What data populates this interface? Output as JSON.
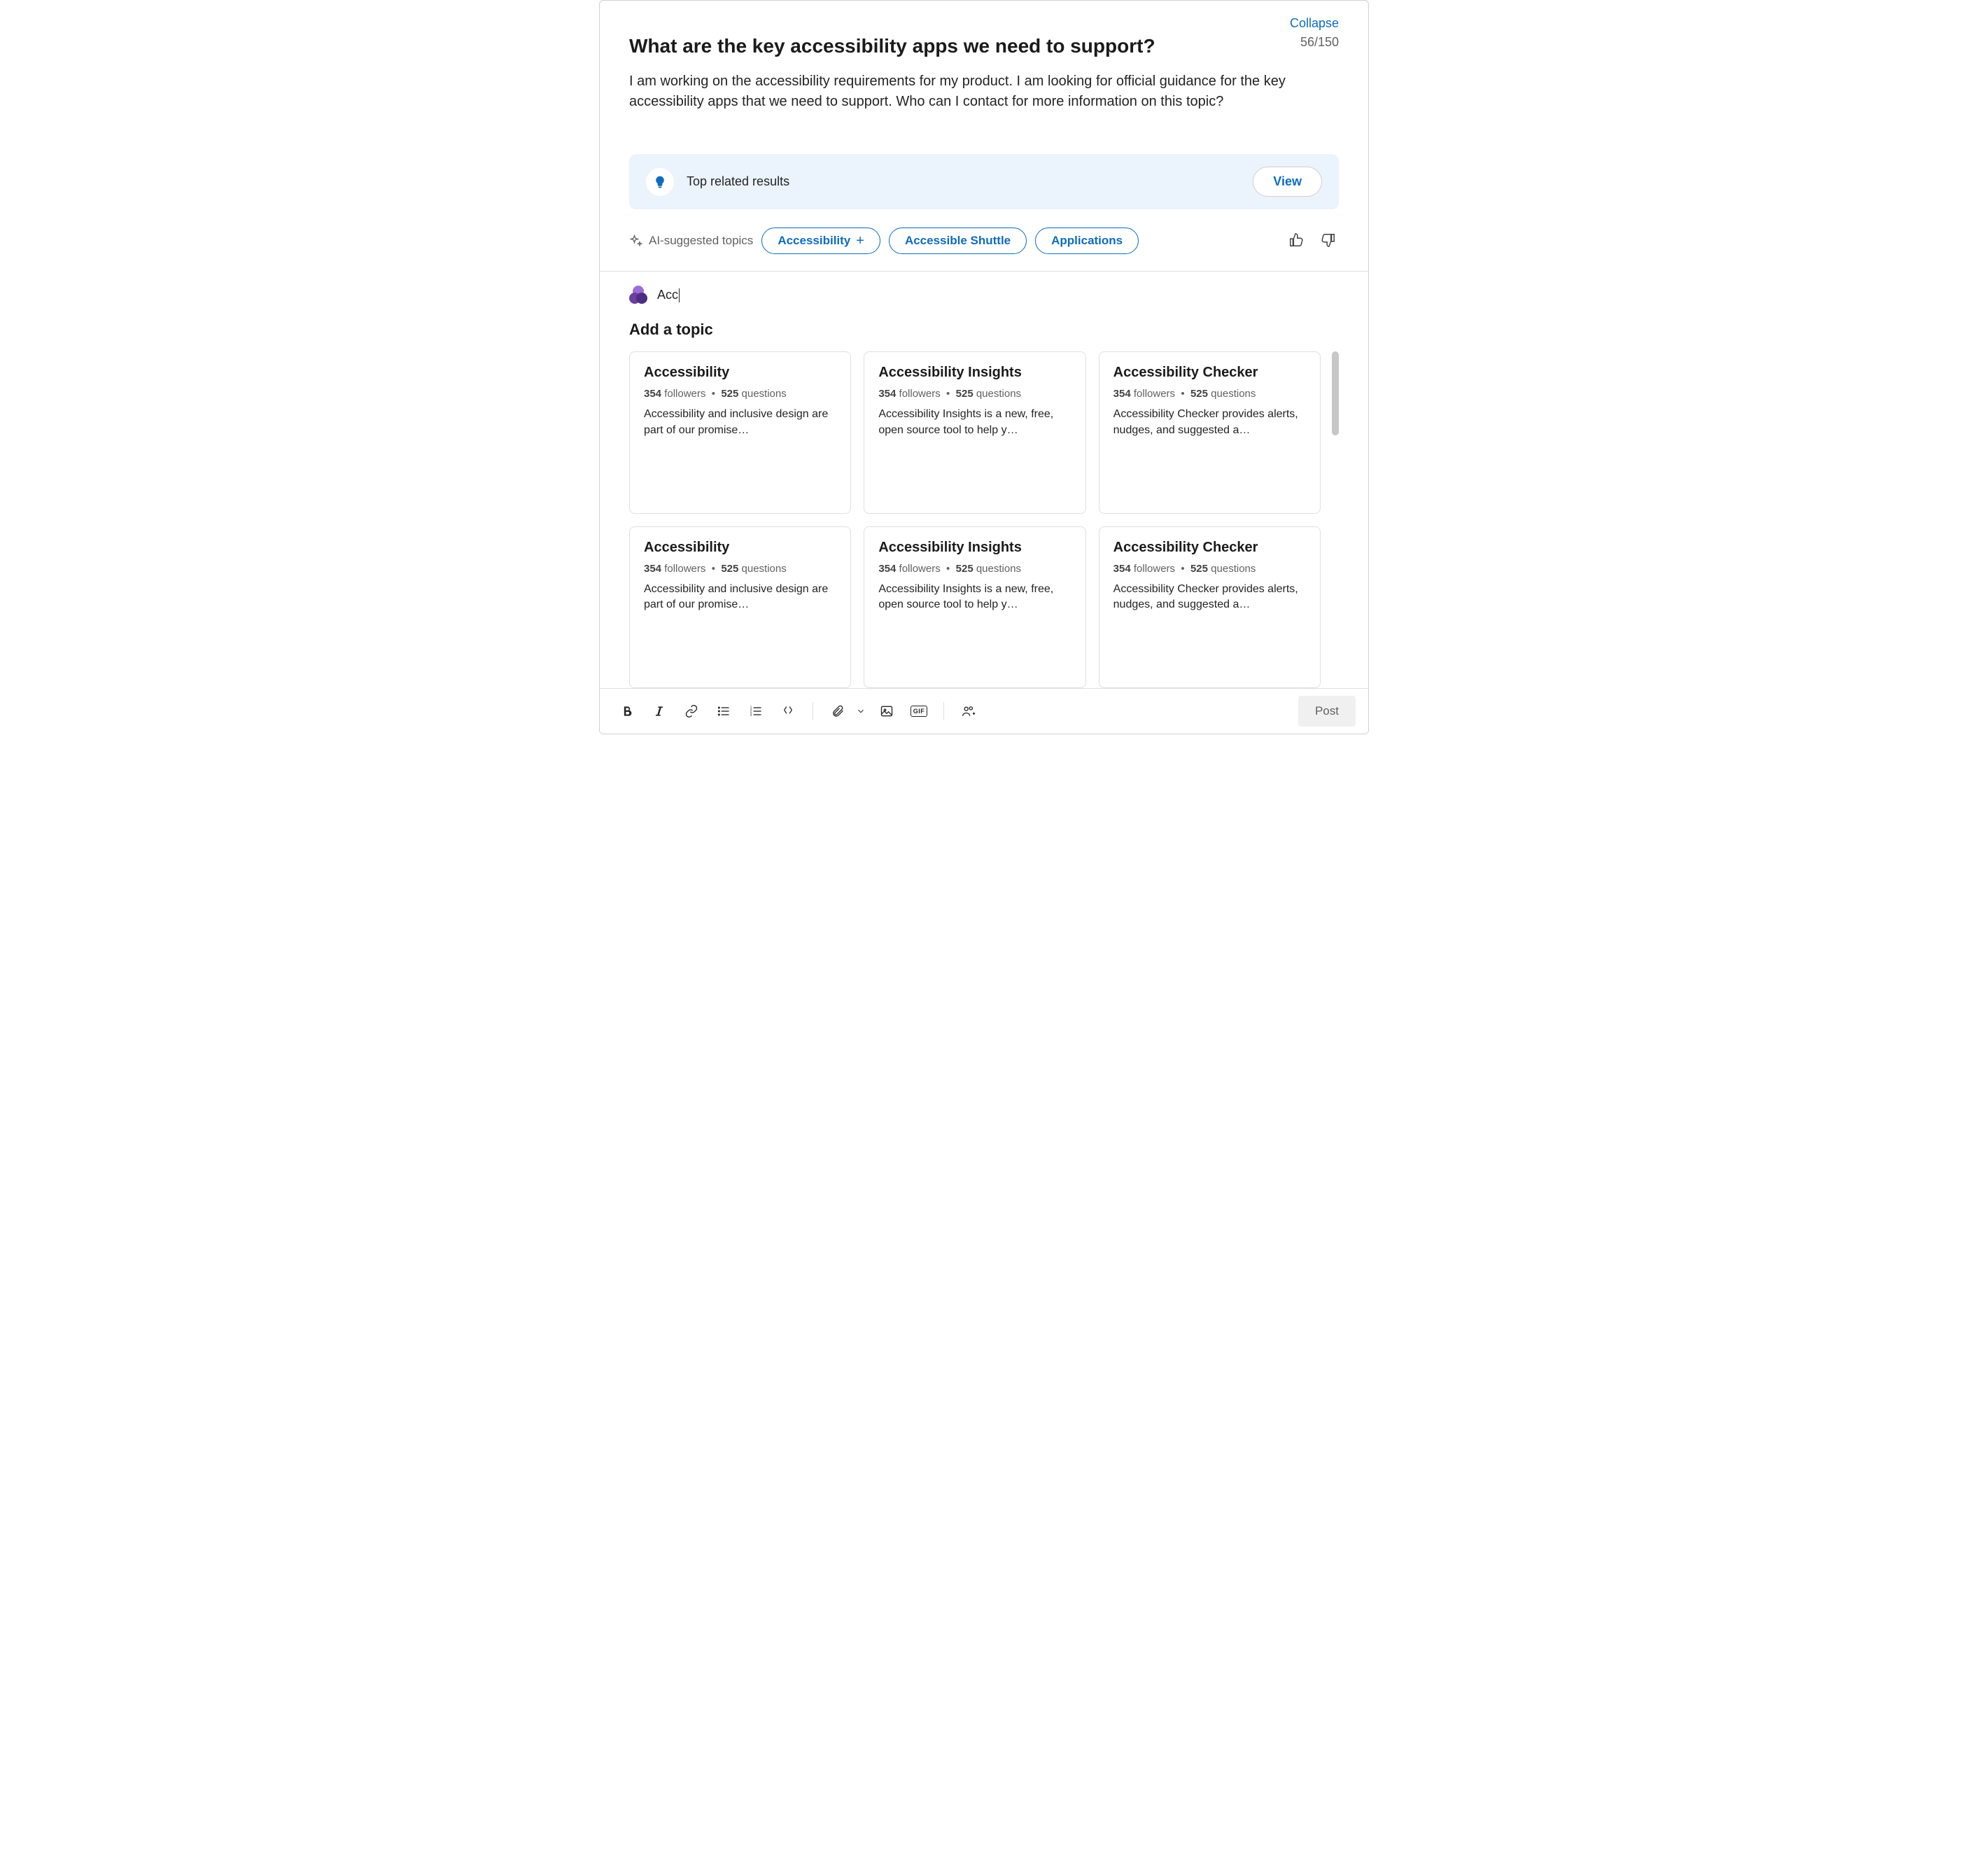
{
  "top": {
    "collapse": "Collapse",
    "counter": "56/150"
  },
  "question": {
    "title": "What are the key accessibility apps we need to support?",
    "body": "I am working on the accessibility requirements for my product. I am looking for official guidance for the key accessibility apps that we need to support. Who can I contact for more information on this topic?"
  },
  "related": {
    "label": "Top related results",
    "view_button": "View"
  },
  "suggested": {
    "label": "AI-suggested topics",
    "chips": [
      {
        "text": "Accessibility",
        "has_plus": true
      },
      {
        "text": "Accessible Shuttle",
        "has_plus": false
      },
      {
        "text": "Applications",
        "has_plus": false
      }
    ]
  },
  "topic_input": {
    "value": "Acc"
  },
  "add_topic": {
    "heading": "Add a topic",
    "cards": [
      {
        "title": "Accessibility",
        "followers": "354",
        "followers_label": "followers",
        "questions": "525",
        "questions_label": "questions",
        "desc": "Accessibility and inclusive design are part of our promise…"
      },
      {
        "title": "Accessibility Insights",
        "followers": "354",
        "followers_label": "followers",
        "questions": "525",
        "questions_label": "questions",
        "desc": "Accessibility Insights is a new, free, open source tool to help y…"
      },
      {
        "title": "Accessibility Checker",
        "followers": "354",
        "followers_label": "followers",
        "questions": "525",
        "questions_label": "questions",
        "desc": "Accessibility Checker provides alerts, nudges, and suggested a…"
      },
      {
        "title": "Accessibility",
        "followers": "354",
        "followers_label": "followers",
        "questions": "525",
        "questions_label": "questions",
        "desc": "Accessibility and inclusive design are part of our promise…"
      },
      {
        "title": "Accessibility Insights",
        "followers": "354",
        "followers_label": "followers",
        "questions": "525",
        "questions_label": "questions",
        "desc": "Accessibility Insights is a new, free, open source tool to help y…"
      },
      {
        "title": "Accessibility Checker",
        "followers": "354",
        "followers_label": "followers",
        "questions": "525",
        "questions_label": "questions",
        "desc": "Accessibility Checker provides alerts, nudges, and suggested a…"
      }
    ],
    "separator": "•"
  },
  "toolbar": {
    "post": "Post",
    "gif_label": "GIF"
  }
}
